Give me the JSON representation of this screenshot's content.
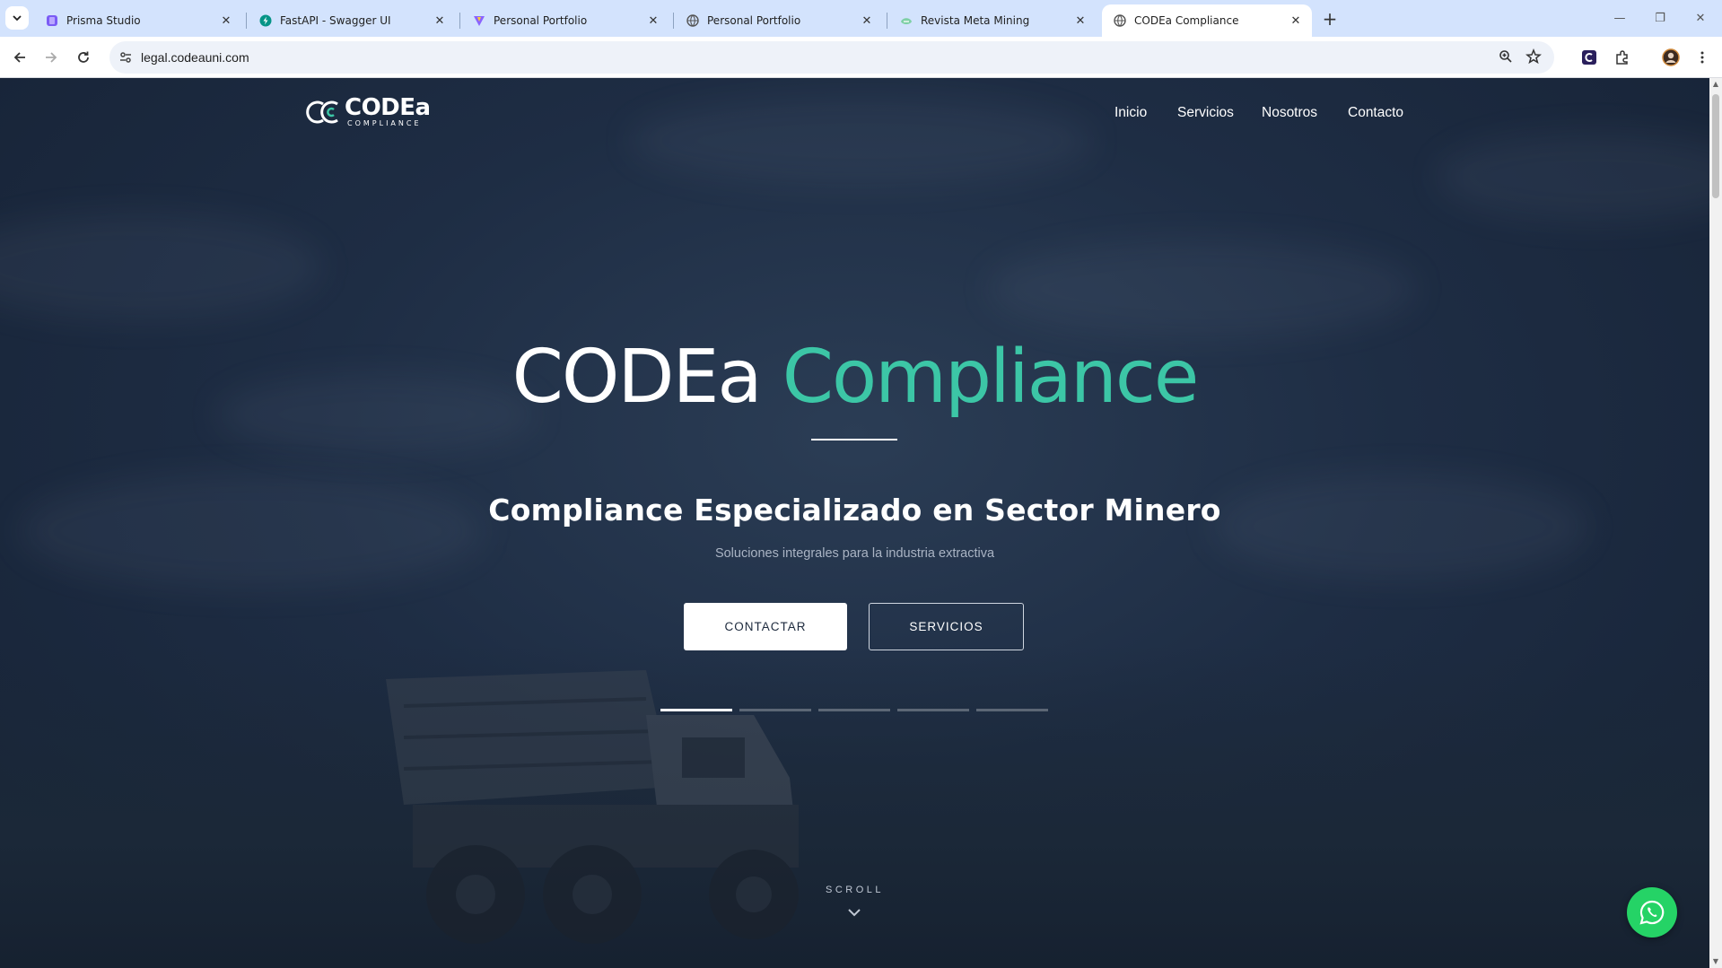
{
  "browser": {
    "tabs": [
      {
        "title": "Prisma Studio",
        "favicon": "prisma-icon",
        "active": false
      },
      {
        "title": "FastAPI - Swagger UI",
        "favicon": "fastapi-icon",
        "active": false
      },
      {
        "title": "Personal Portfolio",
        "favicon": "vite-icon",
        "active": false
      },
      {
        "title": "Personal Portfolio",
        "favicon": "globe-icon",
        "active": false
      },
      {
        "title": "Revista Meta Mining",
        "favicon": "meta-mining-icon",
        "active": false
      },
      {
        "title": "CODEa Compliance",
        "favicon": "globe-icon",
        "active": true
      }
    ],
    "new_tab_icon": "plus-icon",
    "address": "legal.codeauni.com",
    "colors": {
      "tabstrip": "#d3e3fd",
      "omnibox": "#eef2f9"
    }
  },
  "site": {
    "logo": {
      "name": "CODEa",
      "subtitle": "COMPLIANCE"
    },
    "nav": [
      "Inicio",
      "Servicios",
      "Nosotros",
      "Contacto"
    ],
    "hero": {
      "title_part1": "CODEa",
      "title_part2": "Compliance",
      "subtitle": "Compliance Especializado en Sector Minero",
      "tagline": "Soluciones integrales para la industria extractiva",
      "primary_button": "CONTACTAR",
      "secondary_button": "SERVICIOS",
      "slides_total": 5,
      "slide_active": 1,
      "scroll_label": "SCROLL"
    },
    "colors": {
      "accent": "#3cc6a6",
      "background": "#1e2d44",
      "whatsapp": "#25d366"
    }
  }
}
